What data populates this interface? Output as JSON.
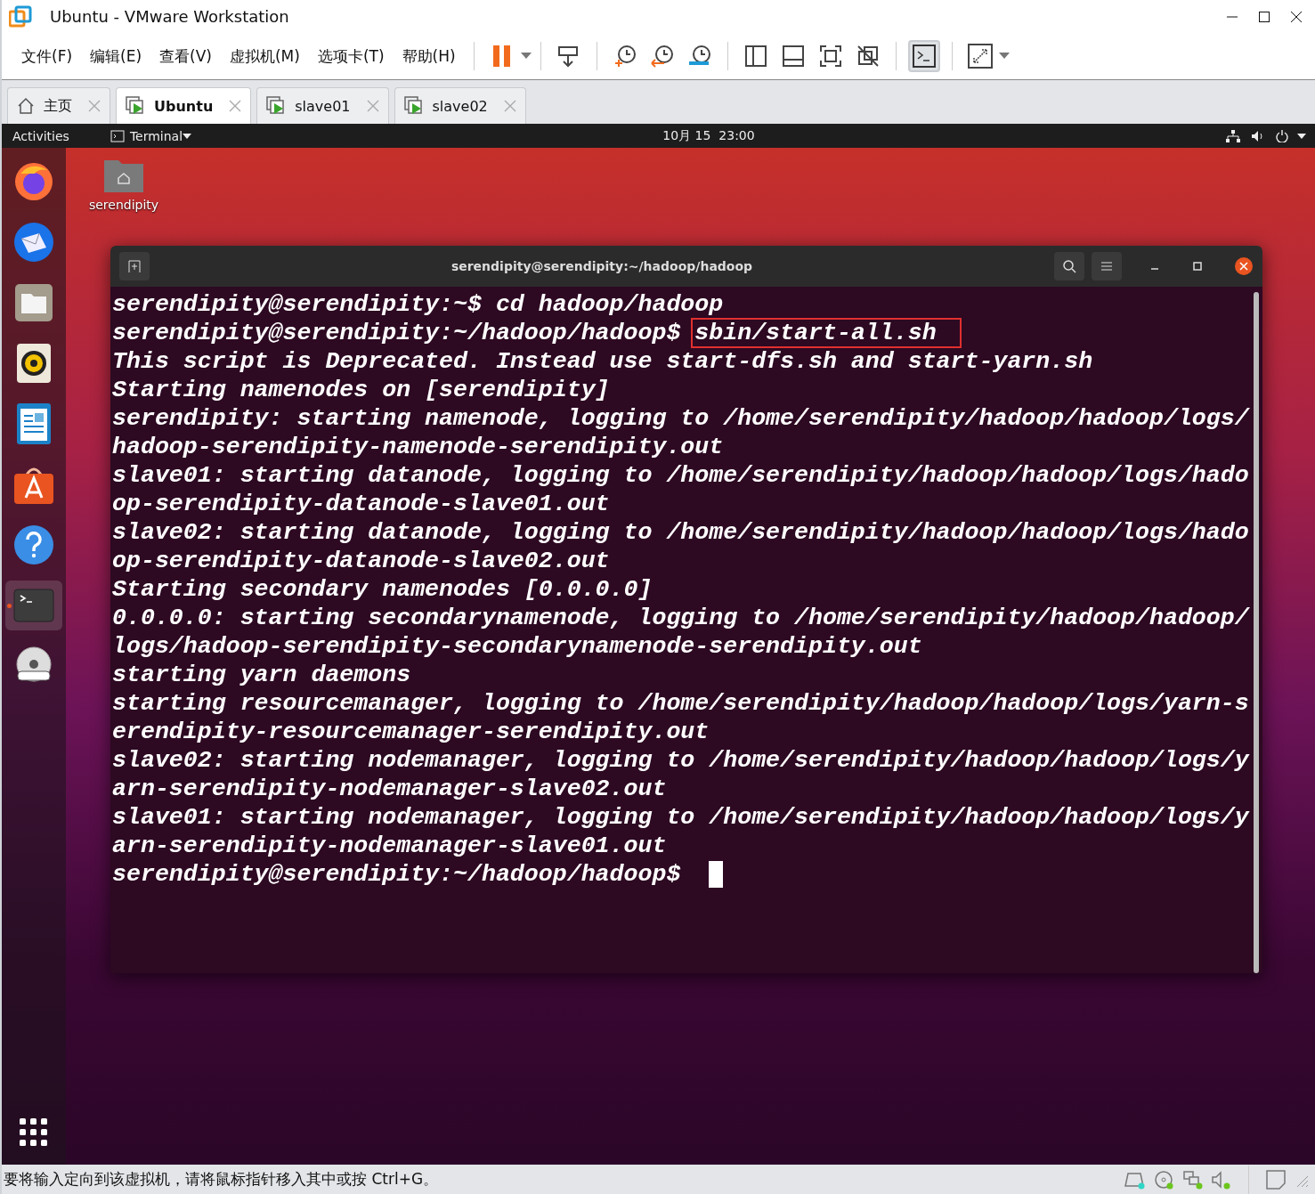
{
  "window": {
    "title": "Ubuntu - VMware Workstation"
  },
  "menu": [
    "文件(F)",
    "编辑(E)",
    "查看(V)",
    "虚拟机(M)",
    "选项卡(T)",
    "帮助(H)"
  ],
  "toolbar": {
    "console_view_on": true
  },
  "tabs": [
    {
      "label": "主页",
      "kind": "home",
      "selected": false
    },
    {
      "label": "Ubuntu",
      "kind": "vm",
      "selected": true
    },
    {
      "label": "slave01",
      "kind": "vm",
      "selected": false
    },
    {
      "label": "slave02",
      "kind": "vm",
      "selected": false
    }
  ],
  "topbar": {
    "activities": "Activities",
    "app": "Terminal",
    "clock": "10月 15  23:00"
  },
  "dock": [
    {
      "kind": "firefox",
      "selected": false
    },
    {
      "kind": "mail",
      "selected": false
    },
    {
      "kind": "files",
      "selected": false
    },
    {
      "kind": "music",
      "selected": false
    },
    {
      "kind": "writer",
      "selected": false
    },
    {
      "kind": "store",
      "selected": false
    },
    {
      "kind": "help",
      "selected": false
    },
    {
      "kind": "terminal",
      "selected": true
    },
    {
      "kind": "dvd",
      "selected": false
    }
  ],
  "desktop_icon": {
    "label": "serendipity"
  },
  "terminal": {
    "title": "serendipity@serendipity:~/hadoop/hadoop",
    "lines": [
      {
        "prompt": "serendipity@serendipity:~$ ",
        "command": "cd hadoop/hadoop",
        "highlighted": false
      },
      {
        "prompt": "serendipity@serendipity:~/hadoop/hadoop$ ",
        "command": "sbin/start-all.sh",
        "highlighted": true
      },
      {
        "text": "This script is Deprecated. Instead use start-dfs.sh and start-yarn.sh"
      },
      {
        "text": "Starting namenodes on [serendipity]"
      },
      {
        "text": "serendipity: starting namenode, logging to /home/serendipity/hadoop/hadoop/logs/"
      },
      {
        "text": "hadoop-serendipity-namenode-serendipity.out"
      },
      {
        "text": "slave01: starting datanode, logging to /home/serendipity/hadoop/hadoop/logs/hado"
      },
      {
        "text": "op-serendipity-datanode-slave01.out"
      },
      {
        "text": "slave02: starting datanode, logging to /home/serendipity/hadoop/hadoop/logs/hado"
      },
      {
        "text": "op-serendipity-datanode-slave02.out"
      },
      {
        "text": "Starting secondary namenodes [0.0.0.0]"
      },
      {
        "text": "0.0.0.0: starting secondarynamenode, logging to /home/serendipity/hadoop/hadoop/"
      },
      {
        "text": "logs/hadoop-serendipity-secondarynamenode-serendipity.out"
      },
      {
        "text": "starting yarn daemons"
      },
      {
        "text": "starting resourcemanager, logging to /home/serendipity/hadoop/hadoop/logs/yarn-s"
      },
      {
        "text": "erendipity-resourcemanager-serendipity.out"
      },
      {
        "text": "slave02: starting nodemanager, logging to /home/serendipity/hadoop/hadoop/logs/y"
      },
      {
        "text": "arn-serendipity-nodemanager-slave02.out"
      },
      {
        "text": "slave01: starting nodemanager, logging to /home/serendipity/hadoop/hadoop/logs/y"
      },
      {
        "text": "arn-serendipity-nodemanager-slave01.out"
      },
      {
        "prompt": "serendipity@serendipity:~/hadoop/hadoop$ ",
        "cursor": true
      }
    ]
  },
  "status": {
    "message": "要将输入定向到该虚拟机，请将鼠标指针移入其中或按 Ctrl+G。"
  }
}
